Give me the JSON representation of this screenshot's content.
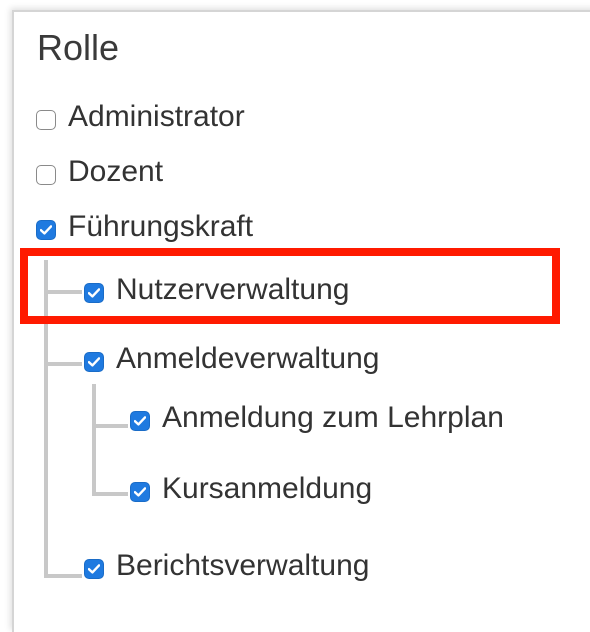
{
  "heading": "Rolle",
  "roles": [
    {
      "label": "Administrator",
      "checked": false
    },
    {
      "label": "Dozent",
      "checked": false
    },
    {
      "label": "Führungskraft",
      "checked": true
    }
  ],
  "permissions": {
    "nutzerverwaltung": {
      "label": "Nutzerverwaltung",
      "checked": true
    },
    "anmeldeverwaltung": {
      "label": "Anmeldeverwaltung",
      "checked": true
    },
    "anmeldung_lehrplan": {
      "label": "Anmeldung zum Lehrplan",
      "checked": true
    },
    "kursanmeldung": {
      "label": "Kursanmeldung",
      "checked": true
    },
    "berichtsverwaltung": {
      "label": "Berichtsverwaltung",
      "checked": true
    }
  },
  "colors": {
    "checkbox_checked": "#1f7ae0",
    "highlight": "#ff1a00",
    "tree_line": "#c8c8c8"
  }
}
